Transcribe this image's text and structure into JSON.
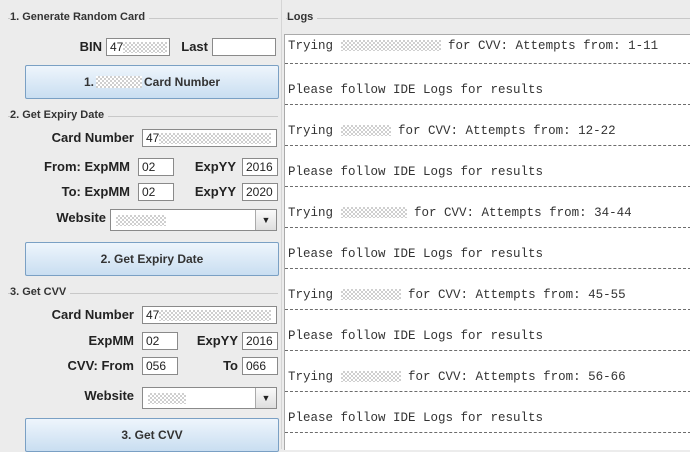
{
  "section1": {
    "title": "1. Generate Random Card",
    "bin_label": "BIN",
    "bin_value": "47",
    "last_label": "Last",
    "last_value": "",
    "button_prefix": "1.",
    "button_suffix": "Card Number"
  },
  "section2": {
    "title": "2. Get Expiry Date",
    "card_number_label": "Card Number",
    "card_number_value": "47",
    "from_expmm_label": "From: ExpMM",
    "from_expmm_value": "02",
    "from_expyy_label": "ExpYY",
    "from_expyy_value": "2016",
    "to_expmm_label": "To: ExpMM",
    "to_expmm_value": "02",
    "to_expyy_label": "ExpYY",
    "to_expyy_value": "2020",
    "website_label": "Website",
    "button_label": "2. Get Expiry Date"
  },
  "section3": {
    "title": "3. Get CVV",
    "card_number_label": "Card Number",
    "card_number_value": "47",
    "expmm_label": "ExpMM",
    "expmm_value": "02",
    "expyy_label": "ExpYY",
    "expyy_value": "2016",
    "cvv_from_label": "CVV: From",
    "cvv_from_value": "056",
    "to_label": "To",
    "to_value": "066",
    "website_label": "Website",
    "button_label": "3. Get CVV"
  },
  "logs": {
    "title": "Logs",
    "trying": "Trying",
    "follow_text": "Please follow IDE Logs for results",
    "entries": [
      {
        "attempts": "for CVV: Attempts from: 1-11"
      },
      {
        "attempts": "for CVV: Attempts from: 12-22"
      },
      {
        "attempts": "for CVV: Attempts from: 34-44"
      },
      {
        "attempts": "for CVV: Attempts from: 45-55"
      },
      {
        "attempts": "for CVV: Attempts from: 56-66"
      }
    ]
  },
  "icons": {
    "dropdown": "chevron-down-icon"
  },
  "colors": {
    "button_top": "#eef5fc",
    "button_bottom": "#c9def1",
    "button_border": "#7aa0c4"
  }
}
